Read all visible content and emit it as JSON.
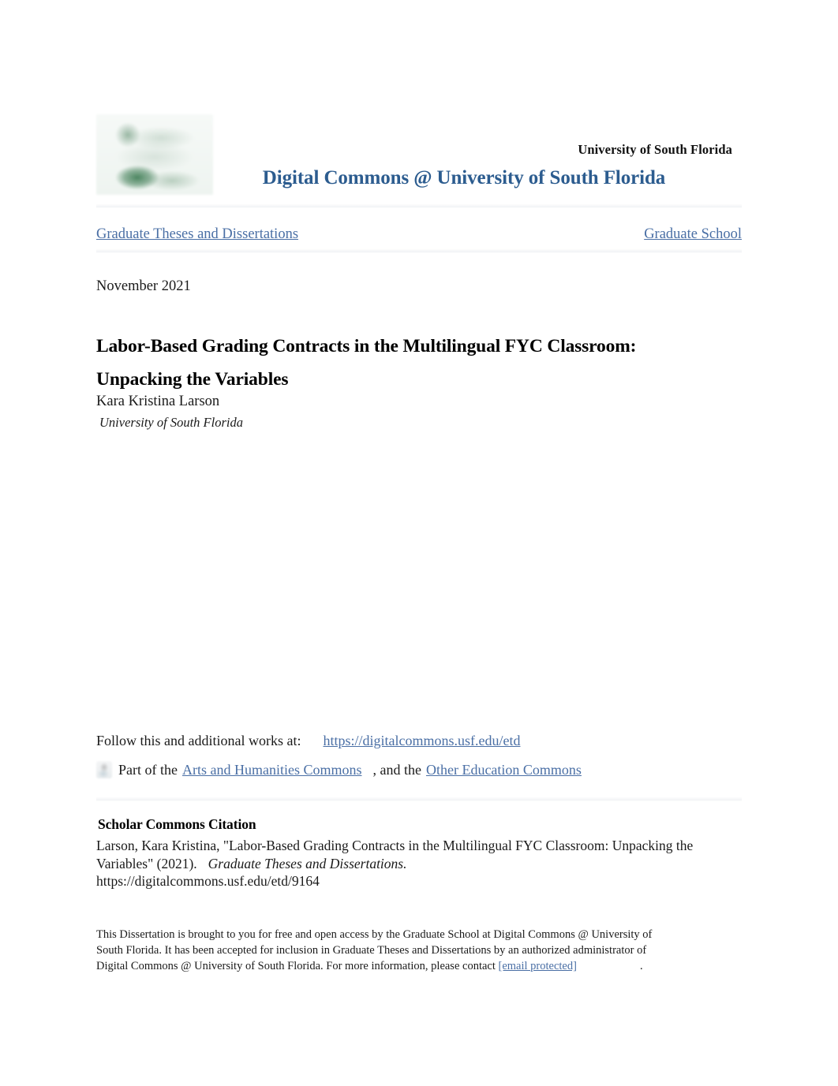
{
  "masthead": {
    "logo_icon": "usf-green-logo",
    "university": "University of South Florida",
    "repository_title": "Digital Commons @ University of South Florida"
  },
  "nav": {
    "left_label": "Graduate Theses and Dissertations",
    "right_label": "Graduate School"
  },
  "record": {
    "publication_date": "November 2021",
    "title": "Labor-Based Grading Contracts in the Multilingual FYC Classroom: Unpacking the Variables",
    "author": "Kara Kristina Larson",
    "affiliation": "University of South Florida"
  },
  "follow": {
    "prefix": "Follow this and additional works at:",
    "url": "https://digitalcommons.usf.edu/etd",
    "commons_icon": "commons-disciplines-icon",
    "part_of_prefix": "Part of the",
    "discipline_1": "Arts and Humanities Commons",
    "connector": ", and the",
    "discipline_2": "Other Education Commons"
  },
  "citation": {
    "heading": "Scholar Commons Citation",
    "text_1": "Larson, Kara Kristina, \"Labor-Based Grading Contracts in the Multilingual FYC Classroom: Unpacking the Variables\" (2021).",
    "series_italic": "Graduate Theses and Dissertations.",
    "url": "https://digitalcommons.usf.edu/etd/9164"
  },
  "footer": {
    "text": "This Dissertation is brought to you for free and open access by the Graduate School at Digital Commons @ University of South Florida. It has been accepted for inclusion in Graduate Theses and Dissertations by an authorized administrator of Digital Commons @ University of South Florida. For more information, please contact",
    "email": "[email protected]",
    "period": "."
  },
  "colors": {
    "link_blue": "#4a6fa5",
    "title_blue": "#2c5c8f",
    "logo_green": "#3e7c54",
    "text_black": "#1a1a1a"
  }
}
